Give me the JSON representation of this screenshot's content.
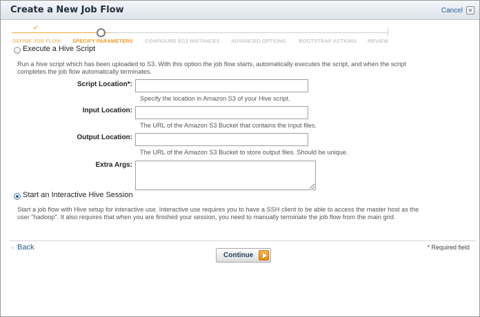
{
  "dialog": {
    "title": "Create a New Job Flow",
    "cancel_label": "Cancel",
    "close_glyph": "×"
  },
  "steps": [
    {
      "label": "DEFINE JOB FLOW",
      "state": "done"
    },
    {
      "label": "SPECIFY PARAMETERS",
      "state": "active"
    },
    {
      "label": "CONFIGURE EC2 INSTANCES",
      "state": "todo"
    },
    {
      "label": "ADVANCED OPTIONS",
      "state": "todo"
    },
    {
      "label": "BOOTSTRAP ACTIONS",
      "state": "todo"
    },
    {
      "label": "REVIEW",
      "state": "todo"
    }
  ],
  "progress": {
    "current_step": 2,
    "total_steps": 6
  },
  "option_script": {
    "label": "Execute a Hive Script",
    "selected": false,
    "description_line1": "Run a hive script which has been uploaded to S3. With this option the job flow starts, automatically executes the script, and when the script",
    "description_line2": "completes the job flow automatically terminates."
  },
  "fields": {
    "script_location": {
      "label": "Script Location*:",
      "value": "",
      "hint": "Specify the location in Amazon S3 of your Hive script."
    },
    "input_location": {
      "label": "Input Location:",
      "value": "",
      "hint": "The URL of the Amazon S3 Bucket that contains the input files."
    },
    "output_location": {
      "label": "Output Location:",
      "value": "",
      "hint": "The URL of the Amazon S3 Bucket to store output files. Should be unique."
    },
    "extra_args": {
      "label": "Extra Args:",
      "value": ""
    }
  },
  "option_interactive": {
    "label": "Start an Interactive Hive Session",
    "selected": true,
    "description_line1": "Start a job flow with Hive setup for interactive use. Interactive use requires you to have a SSH client to be able to access the master host as the",
    "description_line2": "user \"hadoop\". It also requires that when you are finished your session, you need to manually terminate the job flow from the main grid."
  },
  "footer": {
    "back_label": "Back",
    "back_chevron": "‹",
    "continue_label": "Continue",
    "required_note": "* Required field"
  },
  "colors": {
    "accent_orange": "#ef9a2a",
    "link_blue": "#1c5b99"
  }
}
